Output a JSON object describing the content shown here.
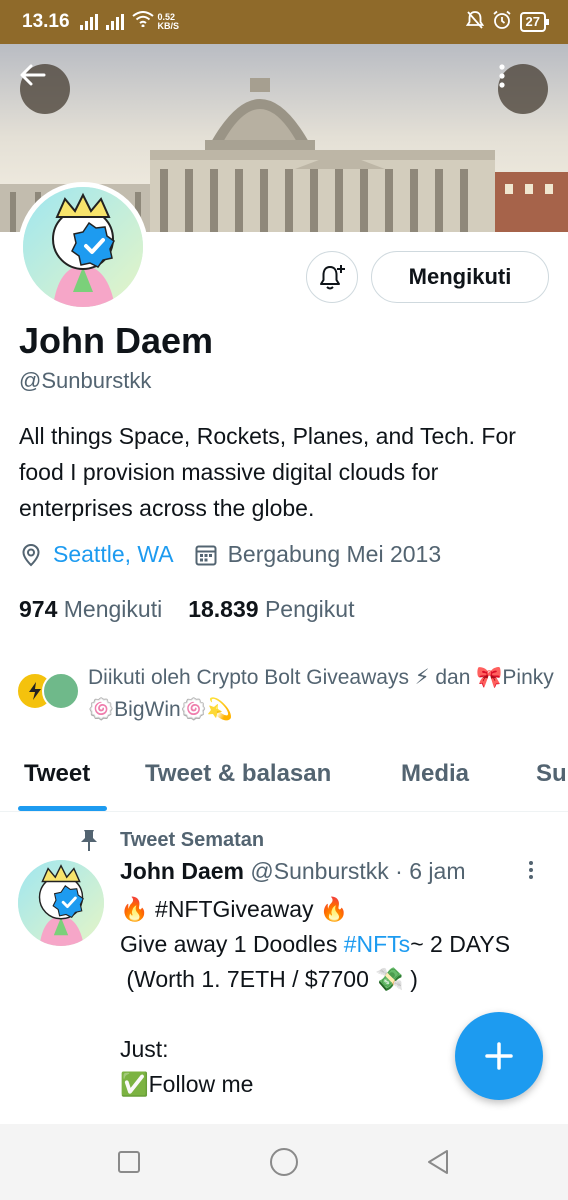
{
  "status_bar": {
    "time": "13.16",
    "speed_value": "0.52",
    "speed_unit": "KB/S",
    "battery": "27"
  },
  "profile": {
    "name": "John Daem",
    "handle": "@Sunburstkk",
    "bio": "All things Space, Rockets, Planes, and Tech. For food I provision massive digital clouds for enterprises across the globe.",
    "location": "Seattle, WA",
    "joined": "Bergabung Mei 2013",
    "following_count": "974",
    "following_label": "Mengikuti",
    "followers_count": "18.839",
    "followers_label": "Pengikut",
    "follow_button": "Mengikuti",
    "followed_by": "Diikuti oleh Crypto Bolt Giveaways ⚡ dan 🎀Pinky🍥BigWin🍥💫"
  },
  "tabs": [
    {
      "label": "Tweet",
      "active": true
    },
    {
      "label": "Tweet & balasan",
      "active": false
    },
    {
      "label": "Media",
      "active": false
    },
    {
      "label": "Su",
      "active": false
    }
  ],
  "tweet": {
    "pinned_label": "Tweet Sematan",
    "author": "John Daem",
    "handle": "@Sunburstkk",
    "dot": "·",
    "time": "6 jam",
    "line1": "🔥 #NFTGiveaway 🔥",
    "line2_pre": "Give away 1 Doodles ",
    "line2_tag": "#NFTs",
    "line2_post": "~ 2 DAYS",
    "line3": " (Worth 1. 7ETH / $7700 💸 )",
    "line4": "Just:",
    "line5": "✅Follow me"
  },
  "colors": {
    "accent": "#1d9bf0",
    "status_bar": "#8f6a2a",
    "text": "#0f1419",
    "muted": "#536471"
  }
}
